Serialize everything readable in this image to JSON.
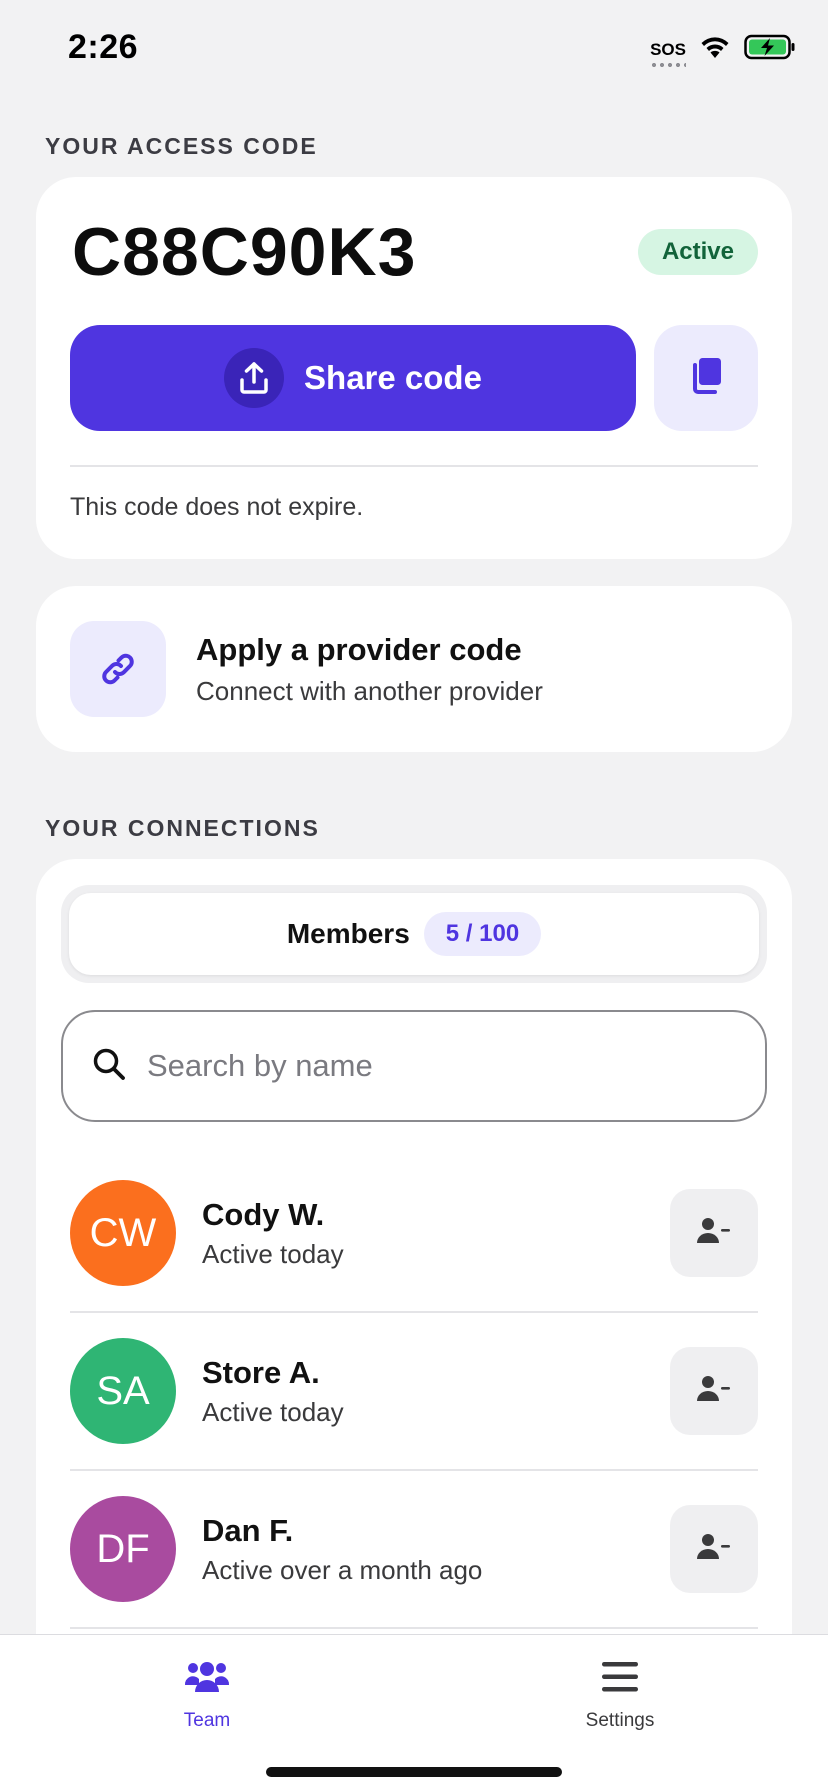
{
  "status_bar": {
    "time": "2:26",
    "sos": "SOS"
  },
  "access": {
    "section_label": "YOUR ACCESS CODE",
    "code": "C88C90K3",
    "badge": "Active",
    "share_label": "Share code",
    "expire_note": "This code does not expire."
  },
  "provider": {
    "title": "Apply a provider code",
    "subtitle": "Connect with another provider"
  },
  "connections": {
    "section_label": "YOUR CONNECTIONS",
    "segment_label": "Members",
    "segment_count": "5 / 100",
    "search_placeholder": "Search by name",
    "members": [
      {
        "initials": "CW",
        "name": "Cody W.",
        "status": "Active today",
        "color": "#fb6f1e"
      },
      {
        "initials": "SA",
        "name": "Store A.",
        "status": "Active today",
        "color": "#2fb574"
      },
      {
        "initials": "DF",
        "name": "Dan F.",
        "status": "Active over a month ago",
        "color": "#a94b9f"
      }
    ]
  },
  "tabs": {
    "team": "Team",
    "settings": "Settings"
  },
  "colors": {
    "accent": "#4f35e0",
    "active_badge_bg": "#d6f5e3",
    "active_badge_text": "#12633a",
    "tab_active": "#4f35e0",
    "tab_inactive": "#3a3a3c"
  },
  "icons": {
    "share": "upload-icon",
    "copy": "copy-icon",
    "provider": "link-icon",
    "search": "search-icon",
    "remove": "remove-user-icon",
    "team": "team-icon",
    "settings": "menu-icon"
  }
}
